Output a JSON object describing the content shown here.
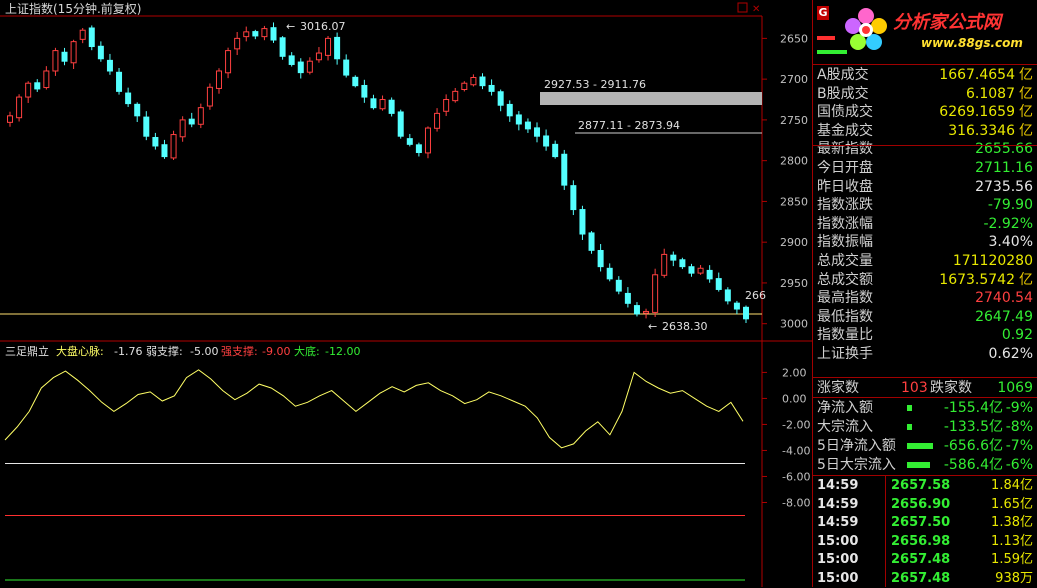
{
  "header": {
    "title": "上证指数(15分钟.前复权)",
    "win_min": "▫",
    "win_close": "✕"
  },
  "price_panel": {
    "y_ticks": [
      "3000",
      "2950",
      "2900",
      "2850",
      "2800",
      "2750",
      "2700",
      "2650"
    ],
    "annot_high": "3016.07",
    "annot_low": "2638.30",
    "zone1": "2927.53 - 2911.76",
    "zone2": "2877.11 - 2873.94",
    "last_label": "266"
  },
  "indicator": {
    "name": "三足鼎立",
    "p1_label": "大盘心脉:",
    "p1_value": "-1.76",
    "p2_label": "弱支撑:",
    "p2_value": "-5.00",
    "p3_label": "强支撑:",
    "p3_value": "-9.00",
    "p4_label": "大底:",
    "p4_value": "-12.00",
    "y_ticks": [
      "2.00",
      "0.00",
      "-2.00",
      "-4.00",
      "-6.00",
      "-8.00"
    ]
  },
  "chart_data": [
    {
      "type": "candlestick",
      "title": "上证指数(15分钟.前复权)",
      "ylim": [
        2630,
        3025
      ],
      "y_ticks": [
        2650,
        2700,
        2750,
        2800,
        2850,
        2900,
        2950,
        3000
      ],
      "annotations": [
        {
          "text": "3016.07",
          "value": 3016.07
        },
        {
          "text": "2638.30",
          "value": 2638.3
        },
        {
          "text": "2927.53 - 2911.76",
          "range": [
            2911.76,
            2927.53
          ]
        },
        {
          "text": "2877.11 - 2873.94",
          "range": [
            2873.94,
            2877.11
          ]
        }
      ],
      "horizontal_line": 2650,
      "closes": [
        2905,
        2928,
        2945,
        2938,
        2960,
        2985,
        2972,
        2996,
        3010,
        2990,
        2975,
        2960,
        2935,
        2920,
        2905,
        2880,
        2868,
        2855,
        2882,
        2900,
        2895,
        2915,
        2940,
        2960,
        2985,
        3000,
        3008,
        3003,
        3012,
        2998,
        2978,
        2968,
        2958,
        2972,
        2982,
        3000,
        2975,
        2955,
        2942,
        2928,
        2915,
        2925,
        2908,
        2880,
        2870,
        2860,
        2890,
        2908,
        2925,
        2935,
        2945,
        2952,
        2942,
        2935,
        2918,
        2905,
        2895,
        2889,
        2880,
        2868,
        2855,
        2820,
        2790,
        2760,
        2740,
        2720,
        2705,
        2690,
        2675,
        2662,
        2665,
        2710,
        2735,
        2728,
        2720,
        2712,
        2718,
        2705,
        2692,
        2678,
        2668,
        2656
      ]
    },
    {
      "type": "line",
      "title": "三足鼎立",
      "ylim": [
        -11.5,
        2.8
      ],
      "y_ticks": [
        2,
        0,
        -2,
        -4,
        -6,
        -8
      ],
      "series": [
        {
          "name": "大盘心脉",
          "values": [
            -3.2,
            -2.2,
            -1.0,
            0.8,
            1.6,
            2.1,
            1.4,
            0.6,
            -0.3,
            -1.0,
            -0.4,
            0.3,
            0.5,
            -0.2,
            0.2,
            1.6,
            2.2,
            1.5,
            0.6,
            -0.1,
            0.4,
            1.1,
            0.8,
            0.2,
            -0.6,
            -0.3,
            0.2,
            0.6,
            -0.2,
            -1.0,
            -0.3,
            0.4,
            0.9,
            0.5,
            1.0,
            1.2,
            0.6,
            0.2,
            -0.4,
            -0.1,
            0.5,
            0.2,
            -0.2,
            -0.6,
            -1.5,
            -3.0,
            -3.8,
            -3.5,
            -2.5,
            -1.8,
            -2.8,
            -1.0,
            2.0,
            1.3,
            0.8,
            0.4,
            0.6,
            0.0,
            -0.6,
            -1.0,
            -0.3,
            -1.76
          ]
        },
        {
          "name": "弱支撑",
          "values": [
            -5.0
          ]
        },
        {
          "name": "强支撑",
          "values": [
            -9.0
          ]
        },
        {
          "name": "大底",
          "values": [
            -12.0
          ]
        }
      ]
    }
  ],
  "sidebar": {
    "g_badge": "G",
    "logo_text": "分析家公式网",
    "logo_url": "www.88gs.com",
    "stats": [
      {
        "label": "A股成交",
        "value": "1667.4654",
        "unit": "亿",
        "color": "#e8e800"
      },
      {
        "label": "B股成交",
        "value": "6.1087",
        "unit": "亿",
        "color": "#e8e800"
      },
      {
        "label": "国债成交",
        "value": "6269.1659",
        "unit": "亿",
        "color": "#e8e800"
      },
      {
        "label": "基金成交",
        "value": "316.3346",
        "unit": "亿",
        "color": "#e8e800"
      },
      {
        "label": "最新指数",
        "value": "2655.66",
        "unit": "",
        "color": "#33ee33"
      },
      {
        "label": "今日开盘",
        "value": "2711.16",
        "unit": "",
        "color": "#33ee33"
      },
      {
        "label": "昨日收盘",
        "value": "2735.56",
        "unit": "",
        "color": "#e6e6e6"
      },
      {
        "label": "指数涨跌",
        "value": "-79.90",
        "unit": "",
        "color": "#33ee33"
      },
      {
        "label": "指数涨幅",
        "value": "-2.92%",
        "unit": "",
        "color": "#33ee33"
      },
      {
        "label": "指数振幅",
        "value": "3.40%",
        "unit": "",
        "color": "#e6e6e6"
      },
      {
        "label": "总成交量",
        "value": "171120280",
        "unit": "",
        "color": "#e8e800"
      },
      {
        "label": "总成交额",
        "value": "1673.5742",
        "unit": "亿",
        "color": "#e8e800"
      },
      {
        "label": "最高指数",
        "value": "2740.54",
        "unit": "",
        "color": "#ff4040"
      },
      {
        "label": "最低指数",
        "value": "2647.49",
        "unit": "",
        "color": "#33ee33"
      },
      {
        "label": "指数量比",
        "value": "0.92",
        "unit": "",
        "color": "#33ee33"
      },
      {
        "label": "上证换手",
        "value": "0.62%",
        "unit": "",
        "color": "#e6e6e6"
      }
    ],
    "updown": {
      "up_label": "涨家数",
      "up_value": "103",
      "down_label": "跌家数",
      "down_value": "1069"
    },
    "flows": [
      {
        "label": "净流入额",
        "value": "-155.4亿",
        "pct": "-9%",
        "bar": 0.15
      },
      {
        "label": "大宗流入",
        "value": "-133.5亿",
        "pct": "-8%",
        "bar": 0.13
      },
      {
        "label": "5日净流入额",
        "value": "-656.6亿",
        "pct": "-7%",
        "bar": 0.8
      },
      {
        "label": "5日大宗流入",
        "value": "-586.4亿",
        "pct": "-6%",
        "bar": 0.72
      }
    ],
    "ticks": [
      {
        "time": "14:59",
        "price": "2657.58",
        "vol": "1.84亿"
      },
      {
        "time": "14:59",
        "price": "2656.90",
        "vol": "1.65亿"
      },
      {
        "time": "14:59",
        "price": "2657.50",
        "vol": "1.38亿"
      },
      {
        "time": "15:00",
        "price": "2656.98",
        "vol": "1.13亿"
      },
      {
        "time": "15:00",
        "price": "2657.48",
        "vol": "1.59亿"
      },
      {
        "time": "15:00",
        "price": "2657.48",
        "vol": "938万"
      }
    ]
  },
  "colors": {
    "up": "#ff4040",
    "down": "#54ffff",
    "grid_red": "#b00000",
    "indicator_line": "#ffff66",
    "axis_text": "#c0c0c0"
  }
}
